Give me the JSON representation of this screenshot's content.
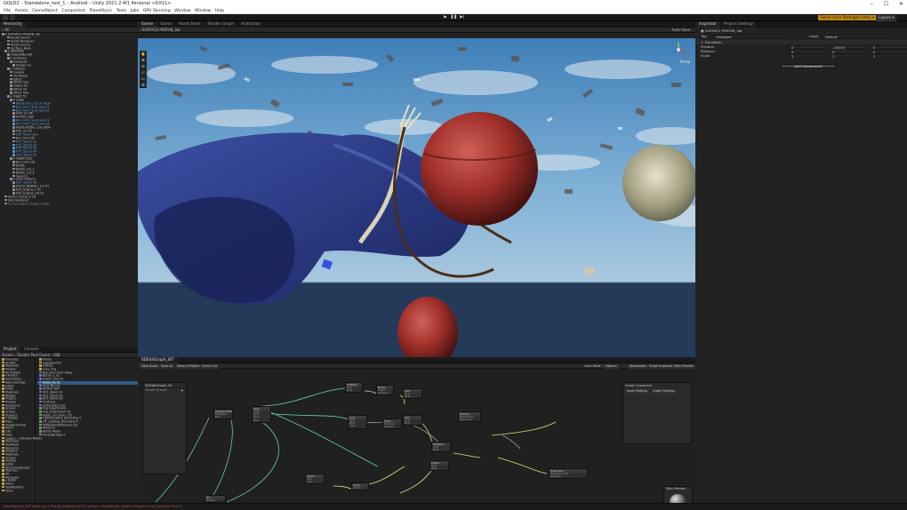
{
  "window": {
    "title": "GOLD2 – Standalone_test_1 – Android – Unity 2021.2.4f1 Personal <DX11>",
    "controls": [
      "–",
      "☐",
      "✕"
    ]
  },
  "menu": [
    "File",
    "Assets",
    "GameObject",
    "Component",
    "PlanetSync",
    "Tools",
    "Jobs",
    "GPU Skinning",
    "Window",
    "Window",
    "Help"
  ],
  "toolbar": {
    "play": "▶",
    "pause": "❚❚",
    "step": "▶|",
    "packages_warning": "Some error Packages Unity ▾",
    "layers": "Layers ▾",
    "layout": "Layout ▾"
  },
  "hierarchy": {
    "tab": "Hierarchy",
    "search_placeholder": "All",
    "items": [
      {
        "label": "▾ SURFACE PREFAB_lab",
        "style": "",
        "indent": 0
      },
      {
        "label": "Audio Source",
        "style": "",
        "indent": 2
      },
      {
        "label": "Audio Renderer",
        "style": "",
        "indent": 2
      },
      {
        "label": "Audio Source",
        "style": "",
        "indent": 2
      },
      {
        "label": "Surface_Base",
        "style": "",
        "indent": 2
      },
      {
        "label": "▾ SURFACE",
        "style": "",
        "indent": 1
      },
      {
        "label": "ObjectsBucket",
        "style": "",
        "indent": 2
      },
      {
        "label": "▾ Surfaces",
        "style": "",
        "indent": 2
      },
      {
        "label": "GroupLid",
        "style": "",
        "indent": 3
      },
      {
        "label": "Design 01",
        "style": "",
        "indent": 4
      },
      {
        "label": "▾ CABLES",
        "style": "",
        "indent": 2
      },
      {
        "label": "Lowlod",
        "style": "",
        "indent": 3
      },
      {
        "label": "Surfmesh",
        "style": "",
        "indent": 3
      },
      {
        "label": "Effect",
        "style": "",
        "indent": 3
      },
      {
        "label": "Effect Use",
        "style": "",
        "indent": 3
      },
      {
        "label": "Object 02",
        "style": "",
        "indent": 3
      },
      {
        "label": "Effect 03",
        "style": "",
        "indent": 3
      },
      {
        "label": "Effect Use",
        "style": "",
        "indent": 3
      },
      {
        "label": "▾ OBJECTS",
        "style": "",
        "indent": 2
      },
      {
        "label": "▾ Ladle",
        "style": "",
        "indent": 3
      },
      {
        "label": "Bottle Fire_Lid_01 High",
        "style": "blue",
        "indent": 4
      },
      {
        "label": "Bun_Fork_Sub_Low 01",
        "style": "blue",
        "indent": 4
      },
      {
        "label": "Bun_Fork_Sub_Low 02",
        "style": "blue",
        "indent": 4
      },
      {
        "label": "Fork_01 06",
        "style": "",
        "indent": 4
      },
      {
        "label": "Perfect_ball",
        "style": "",
        "indent": 4
      },
      {
        "label": "Bun_Fork_Sub_Low 03",
        "style": "blue",
        "indent": 4
      },
      {
        "label": "Bun_Fork_Sub_Low 04",
        "style": "blue",
        "indent": 4
      },
      {
        "label": "Bottle Bottle_Low_NDA",
        "style": "",
        "indent": 4
      },
      {
        "label": "Fish_01 05",
        "style": "",
        "indent": 4
      },
      {
        "label": "Dirt_Trunk_Bun",
        "style": "blue",
        "indent": 4
      },
      {
        "label": "Bun_Fork 05",
        "style": "",
        "indent": 4
      },
      {
        "label": "Dirt_Stand 01",
        "style": "blue",
        "indent": 4
      },
      {
        "label": "Dirt_Stand 02",
        "style": "blue",
        "indent": 4
      },
      {
        "label": "Dirt_Stand 03",
        "style": "blue",
        "indent": 4
      },
      {
        "label": "Dirt_Stand 04",
        "style": "blue",
        "indent": 4
      },
      {
        "label": "Dirt_Stand 05",
        "style": "blue",
        "indent": 4
      },
      {
        "label": "▾ OBJECTS02",
        "style": "",
        "indent": 3
      },
      {
        "label": "Bun_Fork 06",
        "style": "",
        "indent": 4
      },
      {
        "label": "Bottle",
        "style": "",
        "indent": 4
      },
      {
        "label": "Bottle_Lid_1",
        "style": "",
        "indent": 4
      },
      {
        "label": "Bottle_Lid_2",
        "style": "",
        "indent": 4
      },
      {
        "label": "Spoon 1",
        "style": "",
        "indent": 4
      },
      {
        "label": "▾ Lane Objects",
        "style": "",
        "indent": 3
      },
      {
        "label": "Dirt_Stand 06",
        "style": "blue",
        "indent": 4
      },
      {
        "label": "Stand_MgFilter_Lid 01",
        "style": "",
        "indent": 4
      },
      {
        "label": "Dirt_Engine 1 02",
        "style": "",
        "indent": 4
      },
      {
        "label": "Dirt_Engine_Lid 01",
        "style": "",
        "indent": 4
      },
      {
        "label": "Scene Scene_0 03",
        "style": "",
        "indent": 1
      },
      {
        "label": "Slot Renderer",
        "style": "",
        "indent": 1
      },
      {
        "label": "Surface Base Shader LODH",
        "style": "gray",
        "indent": 1
      }
    ]
  },
  "project": {
    "tabs": [
      "Project",
      "Console"
    ],
    "breadcrumb": "Assets › Shader Pool Game › OBJ",
    "tree": [
      "Favorites",
      "All Mat",
      "Materials",
      "Models",
      "All Prefabs",
      "▾ Assets",
      "Animations",
      "Base Settings",
      "Editor",
      "Fonts",
      "Materials",
      "Models",
      "Plugins",
      "Prefabs",
      "Resources",
      "Scenes",
      "Scripts",
      "Shaders",
      "▾ Shader",
      "Mats",
      "ShaderFormat",
      "Items",
      "Libs",
      "Data",
      "Legacy – Ultimate Mobile",
      "Standard",
      "TextMesh",
      "Resource",
      "Shaders",
      "Materials",
      "Graphs",
      "Sample",
      "Editor",
      "StreamingAssets",
      "Textures",
      "XR",
      "Packages",
      "▸ Editor",
      "Xfiles",
      "TextMeshPro",
      "Unity"
    ],
    "files": [
      {
        "label": "Plants",
        "kind": "folder",
        "selected": false
      },
      {
        "label": "LiquidSurfail",
        "kind": "folder",
        "selected": false
      },
      {
        "label": "ExtFog",
        "kind": "folder",
        "selected": false
      },
      {
        "label": "Cute_Fog",
        "kind": "folder",
        "selected": false
      },
      {
        "label": "Bun Fork Over Away",
        "kind": "mat",
        "selected": false
      },
      {
        "label": "Bottle_1_01",
        "kind": "mat",
        "selected": false
      },
      {
        "label": "Frame_Sub 01",
        "kind": "mat",
        "selected": false
      },
      {
        "label": "Noise_Jiu 01",
        "kind": "mat",
        "selected": true
      },
      {
        "label": "Grid_Fun 01",
        "kind": "mat",
        "selected": false
      },
      {
        "label": "Perfect Ball",
        "kind": "mat",
        "selected": false
      },
      {
        "label": "Dirt_Stand 01",
        "kind": "mat",
        "selected": false
      },
      {
        "label": "Dirt_Stand 02",
        "kind": "mat",
        "selected": false
      },
      {
        "label": "Dirt_Stand 03",
        "kind": "mat",
        "selected": false
      },
      {
        "label": "Grid Sub",
        "kind": "mat",
        "selected": false
      },
      {
        "label": "underwater bot",
        "kind": "mat",
        "selected": false
      },
      {
        "label": "Fog Experiment",
        "kind": "tex",
        "selected": false
      },
      {
        "label": "Fog_Experiment 01",
        "kind": "tex",
        "selected": false
      },
      {
        "label": "Noise_Lid_Flow 1 02",
        "kind": "tex",
        "selected": false
      },
      {
        "label": "LightGenerity_Bounding 4",
        "kind": "tex",
        "selected": false
      },
      {
        "label": "off_Lighting_Bounding 4",
        "kind": "tex",
        "selected": false
      },
      {
        "label": "AllMetallicReflection out",
        "kind": "tex",
        "selected": false
      },
      {
        "label": "Noise Jiu",
        "kind": "tex",
        "selected": false
      },
      {
        "label": "Bottle Water",
        "kind": "tex",
        "selected": false
      },
      {
        "label": "SmokeBridge 4",
        "kind": "tex",
        "selected": false
      }
    ]
  },
  "scene": {
    "tabs": [
      "Scene",
      "Game",
      "Asset Store",
      "Shader Graph",
      "Animation"
    ],
    "active_tab": "Scene",
    "breadcrumb": "SURFACE PREFAB_lab",
    "prefab_bar": "Create",
    "mode": "Persp",
    "auto_save": "Auto Save",
    "tools": [
      "✋",
      "✥",
      "⟳",
      "⤢",
      "▭",
      "⚙"
    ]
  },
  "inspector": {
    "tabs": [
      "Inspector",
      "Project Settings"
    ],
    "object_name": "SURFACE PREFAB_lab",
    "tag_label": "Tag",
    "tag_value": "Untagged",
    "layer_label": "Layer",
    "layer_value": "Default",
    "component": "Transform",
    "rows": [
      {
        "label": "Position",
        "x": "0",
        "y": "-100.00",
        "z": "0"
      },
      {
        "label": "Rotation",
        "x": "0",
        "y": "0",
        "z": "0"
      },
      {
        "label": "Scale",
        "x": "1",
        "y": "1",
        "z": "1"
      }
    ],
    "add_component": "Add Component"
  },
  "shadergraph": {
    "tab": "SDEditGraph_WT",
    "buttons": [
      "Save Asset",
      "Save As",
      "Show In Project",
      "Check Out"
    ],
    "right_buttons": [
      "Blackboard",
      "Graph Inspector",
      "Main Preview"
    ],
    "color_mode_label": "Color Mode",
    "color_mode_value": "<None>",
    "blackboard_title": "SDEditGraph_W",
    "blackboard_subtitle": "Shader Graphs",
    "graph_inspector_title": "Graph Inspector",
    "graph_inspector_tabs": [
      "Node Settings",
      "Graph Settings"
    ],
    "preview_title": "Main Preview",
    "nodes": [
      {
        "title": "Sample Texture",
        "rows": [
          "RGBA(4)",
          "R(1)"
        ]
      },
      {
        "title": "Split",
        "rows": [
          "In(4)",
          "R(1)",
          "G(1)",
          "B(1)"
        ]
      },
      {
        "title": "Multiply",
        "rows": [
          "A(1)",
          "B(1)"
        ]
      },
      {
        "title": "Noise",
        "rows": [
          "UV(2)",
          "Scale(1)"
        ]
      },
      {
        "title": "Add",
        "rows": [
          "A(1)",
          "B(1)"
        ]
      },
      {
        "title": "Lerp",
        "rows": [
          "A(4)",
          "B(4)",
          "T(4)"
        ]
      },
      {
        "title": "Time",
        "rows": [
          "Time(1)",
          "Sine(1)"
        ]
      },
      {
        "title": "Add",
        "rows": [
          "A(1)",
          "B(1)"
        ]
      },
      {
        "title": "Multiply",
        "rows": [
          "A(1)",
          "B(1)"
        ]
      },
      {
        "title": "Power",
        "rows": [
          "A(1)",
          "B(1)"
        ]
      },
      {
        "title": "Fresnel",
        "rows": [
          "Normal(3)",
          "Power(1)"
        ]
      },
      {
        "title": "Fragment",
        "rows": [
          "Base Color(3)",
          "Alpha(1)"
        ]
      },
      {
        "title": "Vector",
        "rows": [
          "X(1)",
          "Y(1)"
        ]
      },
      {
        "title": "Color",
        "rows": [
          "Out(4)"
        ]
      },
      {
        "title": "UV",
        "rows": [
          "Out(4)"
        ]
      }
    ]
  },
  "status": "[Worldspace] URP Warning. a Shader property and a surface variable (No shader compile error) has been found."
}
